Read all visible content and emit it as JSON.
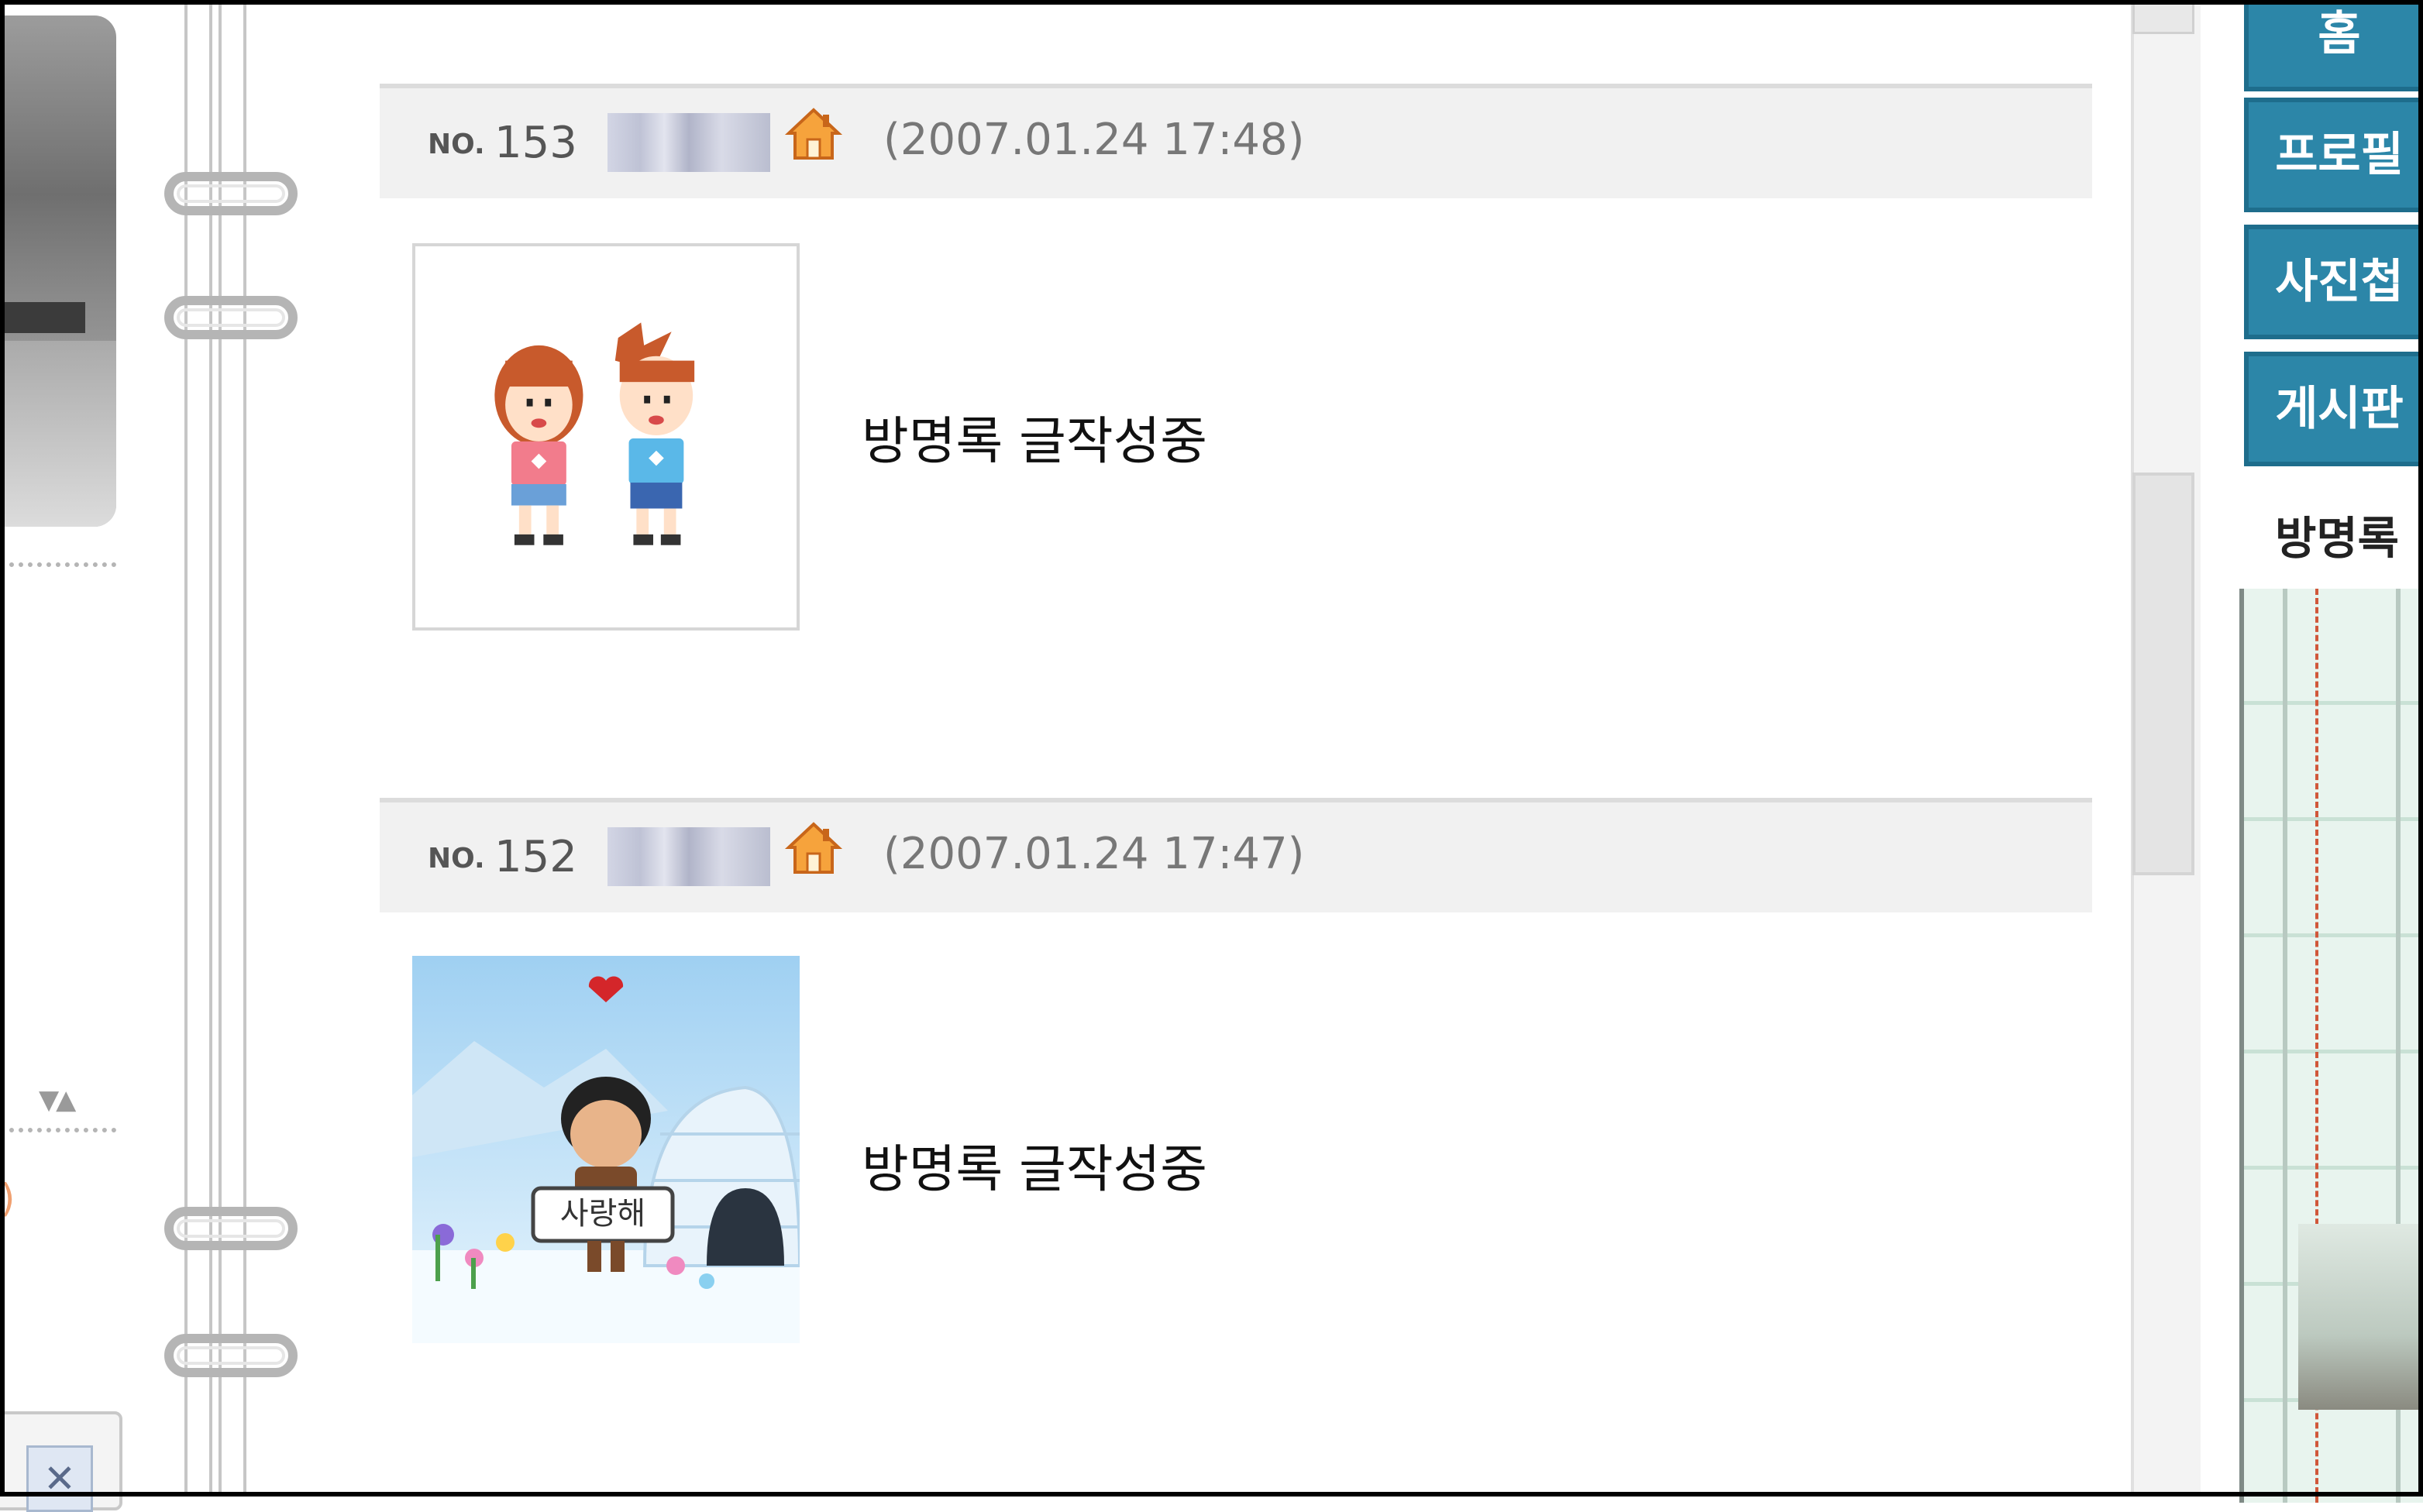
{
  "posts": [
    {
      "no_label": "NO.",
      "number": "153",
      "date": "(2007.01.24 17:48)",
      "text": "방명록 글작성중",
      "avatar": "couple-minimi"
    },
    {
      "no_label": "NO.",
      "number": "152",
      "date": "(2007.01.24 17:47)",
      "text": "방명록 글작성중",
      "avatar": "igloo-minimi"
    }
  ],
  "avatar_sign_text": "사랑해",
  "menu": {
    "tabs": [
      "홈",
      "프로필",
      "사진첩",
      "게시판"
    ],
    "active": "방명록"
  },
  "colors": {
    "menu_tab": "#2c86a8",
    "header_bg": "#f1f1f1",
    "text": "#111111"
  }
}
